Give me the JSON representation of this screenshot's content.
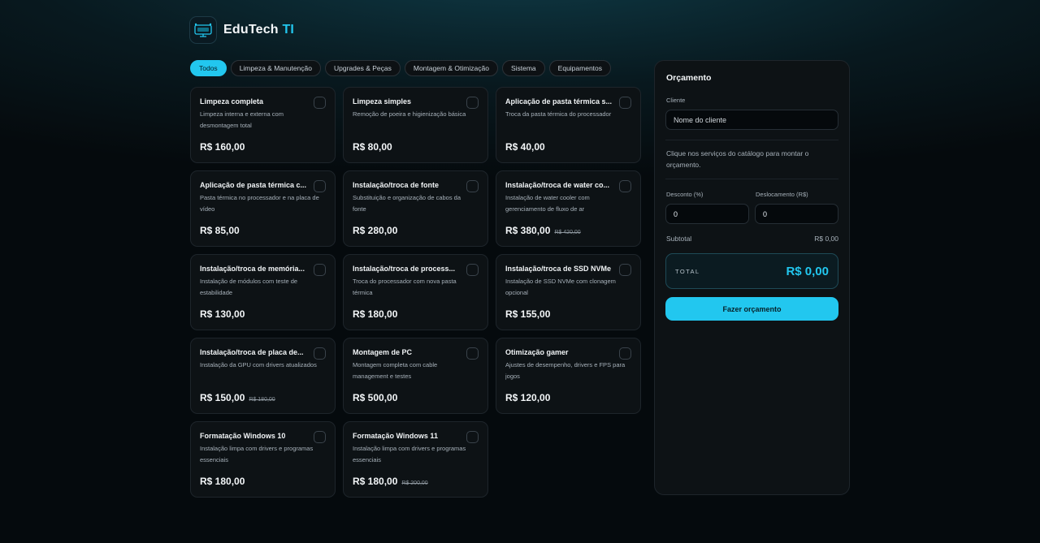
{
  "brand": {
    "name": "EduTech",
    "accent": "TI"
  },
  "filters": [
    {
      "label": "Todos",
      "active": true
    },
    {
      "label": "Limpeza & Manutenção",
      "active": false
    },
    {
      "label": "Upgrades & Peças",
      "active": false
    },
    {
      "label": "Montagem & Otimização",
      "active": false
    },
    {
      "label": "Sistema",
      "active": false
    },
    {
      "label": "Equipamentos",
      "active": false
    }
  ],
  "services": [
    {
      "title": "Limpeza completa",
      "desc": "Limpeza interna e externa com desmontagem total",
      "price": "R$ 160,00",
      "old_price": ""
    },
    {
      "title": "Limpeza simples",
      "desc": "Remoção de poeira e higienização básica",
      "price": "R$ 80,00",
      "old_price": ""
    },
    {
      "title": "Aplicação de pasta térmica s...",
      "desc": "Troca da pasta térmica do processador",
      "price": "R$ 40,00",
      "old_price": ""
    },
    {
      "title": "Aplicação de pasta térmica c...",
      "desc": "Pasta térmica no processador e na placa de vídeo",
      "price": "R$ 85,00",
      "old_price": ""
    },
    {
      "title": "Instalação/troca de fonte",
      "desc": "Substituição e organização de cabos da fonte",
      "price": "R$ 280,00",
      "old_price": ""
    },
    {
      "title": "Instalação/troca de water co...",
      "desc": "Instalação de water cooler com gerenciamento de fluxo de ar",
      "price": "R$ 380,00",
      "old_price": "R$ 420,00"
    },
    {
      "title": "Instalação/troca de memória...",
      "desc": "Instalação de módulos com teste de estabilidade",
      "price": "R$ 130,00",
      "old_price": ""
    },
    {
      "title": "Instalação/troca de process...",
      "desc": "Troca do processador com nova pasta térmica",
      "price": "R$ 180,00",
      "old_price": ""
    },
    {
      "title": "Instalação/troca de SSD NVMe",
      "desc": "Instalação de SSD NVMe com clonagem opcional",
      "price": "R$ 155,00",
      "old_price": ""
    },
    {
      "title": "Instalação/troca de placa de...",
      "desc": "Instalação da GPU com drivers atualizados",
      "price": "R$ 150,00",
      "old_price": "R$ 180,00"
    },
    {
      "title": "Montagem de PC",
      "desc": "Montagem completa com cable management e testes",
      "price": "R$ 500,00",
      "old_price": ""
    },
    {
      "title": "Otimização gamer",
      "desc": "Ajustes de desempenho, drivers e FPS para jogos",
      "price": "R$ 120,00",
      "old_price": ""
    },
    {
      "title": "Formatação Windows 10",
      "desc": "Instalação limpa com drivers e programas essenciais",
      "price": "R$ 180,00",
      "old_price": ""
    },
    {
      "title": "Formatação Windows 11",
      "desc": "Instalação limpa com drivers e programas essenciais",
      "price": "R$ 180,00",
      "old_price": "R$ 200,00"
    }
  ],
  "quote": {
    "title": "Orçamento",
    "client_label": "Cliente",
    "client_placeholder": "Nome do cliente",
    "hint": "Clique nos serviços do catálogo para montar o orçamento.",
    "discount_label": "Desconto (%)",
    "discount_value": "0",
    "travel_label": "Deslocamento (R$)",
    "travel_value": "0",
    "subtotal_label": "Subtotal",
    "subtotal_value": "R$ 0,00",
    "total_label": "TOTAL",
    "total_value": "R$ 0,00",
    "submit_label": "Fazer orçamento"
  },
  "colors": {
    "accent": "#22c7ef",
    "card_bg": "#0d1215",
    "page_bg": "#05090c"
  },
  "icons": {
    "logo": "computer-logo-icon",
    "checkbox": "checkbox-icon"
  }
}
